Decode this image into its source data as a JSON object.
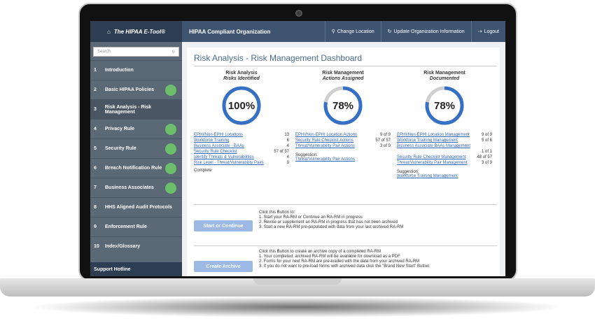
{
  "sidebar": {
    "brand": "The HIPAA E-Tool®",
    "search_placeholder": "Search",
    "items": [
      {
        "num": "1",
        "label": "Introduction",
        "done": false
      },
      {
        "num": "2",
        "label": "Basic HIPAA Policies",
        "done": true
      },
      {
        "num": "3",
        "label": "Risk Analysis - Risk Management",
        "done": false
      },
      {
        "num": "4",
        "label": "Privacy Rule",
        "done": true
      },
      {
        "num": "5",
        "label": "Security Rule",
        "done": true
      },
      {
        "num": "6",
        "label": "Breach Notification Rule",
        "done": true
      },
      {
        "num": "7",
        "label": "Business Associates",
        "done": true
      },
      {
        "num": "8",
        "label": "HHS Aligned Audit Protocols",
        "done": false
      },
      {
        "num": "9",
        "label": "Enforcement Rule",
        "done": false
      },
      {
        "num": "10",
        "label": "Index/Glossary",
        "done": false
      }
    ],
    "support": "Support Hotline"
  },
  "topbar": {
    "org": "HIPAA Compliant Organization",
    "change_location": "Change Location",
    "update_org": "Update Organization Information",
    "logout": "Logout"
  },
  "dashboard": {
    "title": "Risk Analysis - Risk Management Dashboard",
    "columns": [
      {
        "heading": "Risk Analysis",
        "sub": "Risks Identified",
        "percent": "100%",
        "fraction": 1.0,
        "rows": [
          {
            "label": "EPHI/Non-EPHI Locations",
            "value": "13"
          },
          {
            "label": "Workforce Training",
            "value": "6"
          },
          {
            "label": "Business Associate - BAAs",
            "value": "4"
          },
          {
            "label": "Security Rule Checklist",
            "value": "57 of 57"
          },
          {
            "label": "Identify Threats & Vulnerabilities",
            "value": "4"
          },
          {
            "label": "Risk Level - Threat/Vulnerability Pairs",
            "value": "9"
          }
        ],
        "footer": "Complete",
        "suggestion_label": "",
        "suggestion": ""
      },
      {
        "heading": "Risk Management",
        "sub": "Actions Assigned",
        "percent": "78%",
        "fraction": 0.78,
        "rows": [
          {
            "label": "EPHI/Non-EPHI Location Actions",
            "value": "9 of 9"
          },
          {
            "label": "Security Rule Checklist Actions",
            "value": "57 of 57"
          },
          {
            "label": "Threat/Vulnerability Pair Actions",
            "value": "3 of 9"
          }
        ],
        "footer": "",
        "suggestion_label": "Suggestion:",
        "suggestion": "Threat/Vulnerability Pair Actions"
      },
      {
        "heading": "Risk Management",
        "sub": "Documented",
        "percent": "78%",
        "fraction": 0.78,
        "rows": [
          {
            "label": "EPHI/Non-EPHI Location Management",
            "value": "9 of 9"
          },
          {
            "label": "Workforce Training Management",
            "value": "5 of 6"
          },
          {
            "label": "Business Associate BAAs Management",
            "value": ""
          },
          {
            "label": "",
            "value": "1 of 1"
          },
          {
            "label": "Security Rule Checklist Management",
            "value": "48 of 57"
          },
          {
            "label": "Threat/Vulnerability Pair Management",
            "value": "3 of 9"
          }
        ],
        "footer": "",
        "suggestion_label": "Suggestion:",
        "suggestion": "Workforce Training Management"
      }
    ],
    "actions": [
      {
        "button": "Start or Continue",
        "lines": [
          "Click this Button to:",
          "1. Start your RA-RM or Continue an RA-RM in progress",
          "2. Revise or supplement an RA-RM in progress that has not been archived",
          "3. Start a new RA-RM pre-populated with data from your last archived RA-RM"
        ]
      },
      {
        "button": "Create Archive",
        "lines": [
          "Click this Button to create an archive copy of a completed RA-RM",
          "1. Your completed, archived RA-RM will be available for download as a PDF",
          "2. Forms for your next RA-RM are pre-loaded with the data from your archived RA-RM",
          "3. If you do not want to pre-load forms with archived data click the \"Brand New Start\" Button"
        ]
      }
    ]
  },
  "colors": {
    "ring": "#3570c4",
    "ring_bg": "#cfcfcf",
    "done_dot": "#6cbf6a",
    "sidebar": "#5b6876",
    "topbar": "#3f5470"
  }
}
